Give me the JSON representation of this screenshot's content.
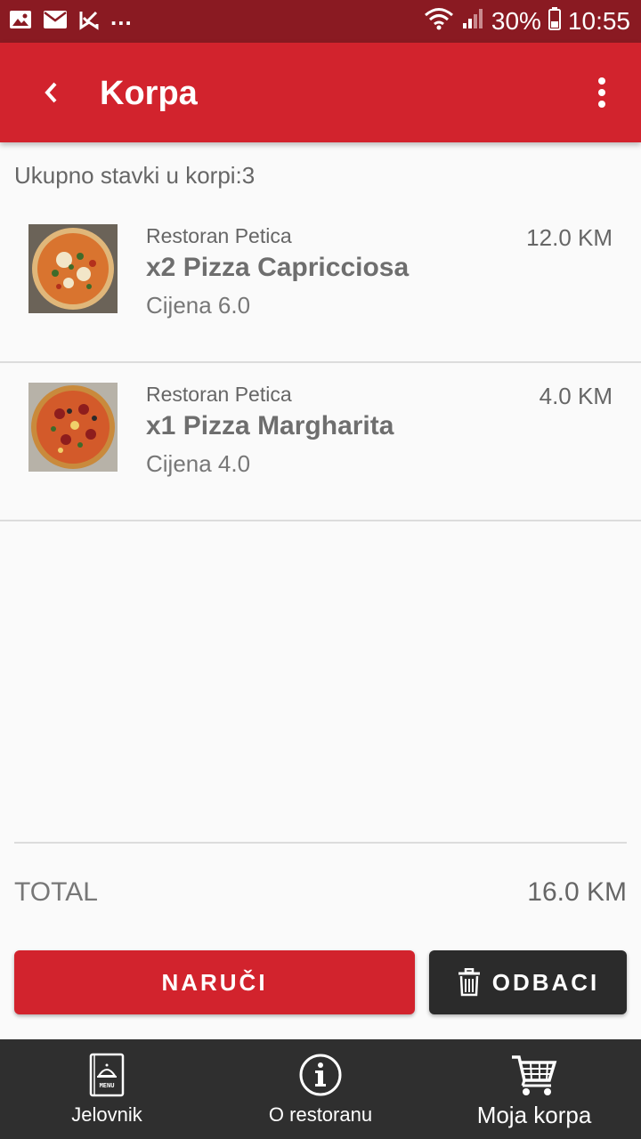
{
  "status_bar": {
    "battery": "30%",
    "time": "10:55",
    "more": "..."
  },
  "app_bar": {
    "title": "Korpa"
  },
  "cart": {
    "count_label": "Ukupno stavki u korpi:3",
    "items": [
      {
        "restaurant": "Restoran Petica",
        "name": "x2 Pizza Capricciosa",
        "price": "Cijena 6.0",
        "total": "12.0 KM"
      },
      {
        "restaurant": "Restoran Petica",
        "name": "x1 Pizza Margharita",
        "price": "Cijena 4.0",
        "total": "4.0 KM"
      }
    ]
  },
  "summary": {
    "total_label": "TOTAL",
    "total_value": "16.0 KM"
  },
  "actions": {
    "order_label": "NARUČI",
    "discard_label": "ODBACI"
  },
  "bottom_nav": [
    {
      "label": "Jelovnik",
      "icon": "menu-book-icon"
    },
    {
      "label": "O restoranu",
      "icon": "info-icon"
    },
    {
      "label": "Moja korpa",
      "icon": "cart-icon"
    }
  ],
  "colors": {
    "primary": "#d2232d",
    "status_bar": "#8a1a22",
    "dark": "#2f2f2f",
    "discard": "#2b2b2b"
  }
}
